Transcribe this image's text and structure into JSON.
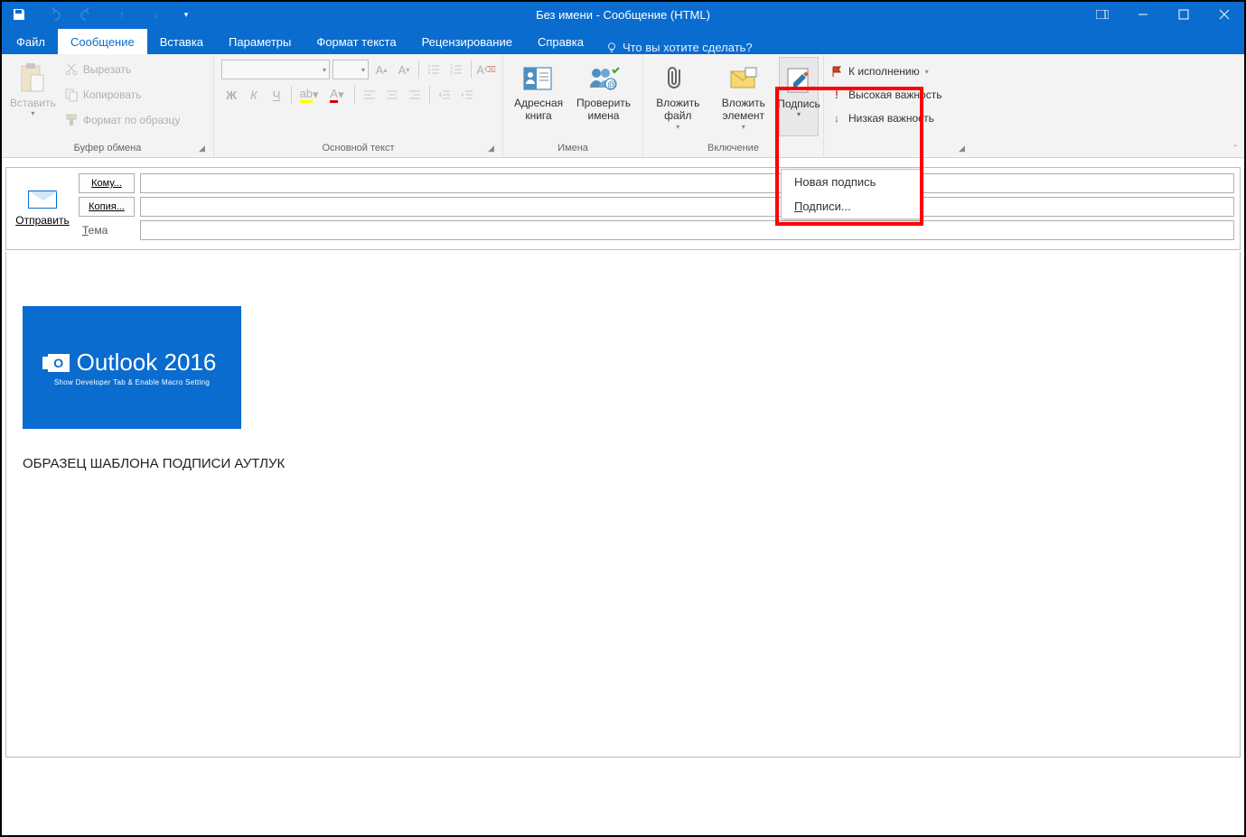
{
  "window": {
    "title": "Без имени  -  Сообщение (HTML)"
  },
  "tabs": {
    "file": "Файл",
    "message": "Сообщение",
    "insert": "Вставка",
    "options": "Параметры",
    "format": "Формат текста",
    "review": "Рецензирование",
    "help": "Справка",
    "tellme": "Что вы хотите сделать?"
  },
  "ribbon": {
    "clipboard": {
      "label": "Буфер обмена",
      "paste": "Вставить",
      "cut": "Вырезать",
      "copy": "Копировать",
      "format_painter": "Формат по образцу"
    },
    "font": {
      "label": "Основной текст",
      "bold": "Ж",
      "italic": "К",
      "underline": "Ч"
    },
    "names": {
      "label": "Имена",
      "address_book": "Адресная книга",
      "check_names": "Проверить имена"
    },
    "include": {
      "label": "Включение",
      "attach_file": "Вложить файл",
      "attach_item": "Вложить элемент",
      "signature": "Подпись"
    },
    "tags": {
      "label": "",
      "follow_up": "К исполнению",
      "high": "Высокая важность",
      "low": "Низкая важность"
    }
  },
  "dropdown": {
    "new_signature": "Новая подпись",
    "signatures": "Подписи..."
  },
  "compose": {
    "send": "Отправить",
    "to": "Кому...",
    "cc": "Копия...",
    "subject": "Тема"
  },
  "body": {
    "banner_title": "Outlook 2016",
    "banner_sub": "Show Developer Tab & Enable Macro Setting",
    "signature_text": "ОБРАЗЕЦ ШАБЛОНА ПОДПИСИ АУТЛУК"
  }
}
